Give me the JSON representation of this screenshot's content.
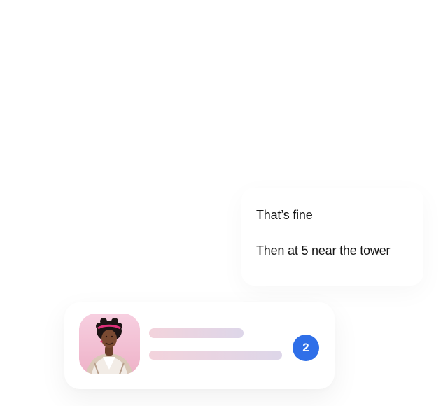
{
  "chat": {
    "messages": [
      {
        "text": "That’s fine"
      },
      {
        "text": "Then at 5 near the tower"
      }
    ]
  },
  "notification": {
    "unread_count": "2",
    "badge_color": "#2f6fe8",
    "avatar_icon": "user-photo"
  }
}
